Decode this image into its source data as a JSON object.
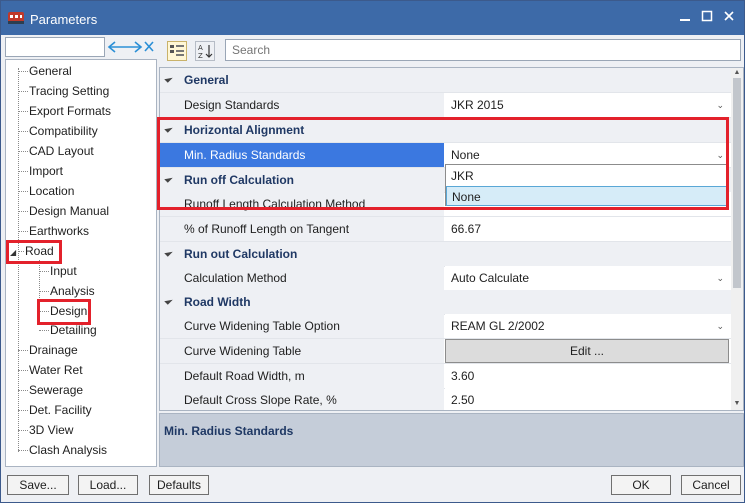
{
  "window": {
    "title": "Parameters",
    "minimize_icon": "minimize-icon",
    "maximize_icon": "maximize-icon",
    "close_icon": "close-icon"
  },
  "tree": {
    "filter_value": "",
    "items": [
      {
        "label": "General"
      },
      {
        "label": "Tracing Setting"
      },
      {
        "label": "Export Formats"
      },
      {
        "label": "Compatibility"
      },
      {
        "label": "CAD Layout"
      },
      {
        "label": "Import"
      },
      {
        "label": "Location"
      },
      {
        "label": "Design Manual"
      },
      {
        "label": "Earthworks"
      },
      {
        "label": "Road"
      },
      {
        "label": "Input"
      },
      {
        "label": "Analysis"
      },
      {
        "label": "Design"
      },
      {
        "label": "Detailing"
      },
      {
        "label": "Drainage"
      },
      {
        "label": "Water Ret"
      },
      {
        "label": "Sewerage"
      },
      {
        "label": "Det. Facility"
      },
      {
        "label": "3D View"
      },
      {
        "label": "Clash Analysis"
      }
    ]
  },
  "toolbar": {
    "search_placeholder": "Search",
    "az_label": "A Z"
  },
  "grid": {
    "general": "General",
    "design_standards": {
      "name": "Design Standards",
      "value": "JKR 2015"
    },
    "horizontal_alignment": "Horizontal Alignment",
    "min_radius": {
      "name": "Min. Radius Standards",
      "value": "None"
    },
    "runoff": "Run off Calculation",
    "runoff_length": {
      "name": "Runoff Length Calculation Method",
      "value": ""
    },
    "runoff_tangent": {
      "name": "% of Runoff Length on Tangent",
      "value": "66.67"
    },
    "runout": "Run out Calculation",
    "calc_method": {
      "name": "Calculation Method",
      "value": "Auto Calculate"
    },
    "road_width": "Road Width",
    "curve_widening_option": {
      "name": "Curve Widening Table Option",
      "value": "REAM GL 2/2002"
    },
    "curve_widening_table": {
      "name": "Curve Widening Table",
      "button": "Edit ..."
    },
    "default_road_width": {
      "name": "Default Road Width, m",
      "value": "3.60"
    },
    "default_cross_slope": {
      "name": "Default Cross Slope Rate, %",
      "value": "2.50"
    }
  },
  "dropdown": {
    "options": [
      "JKR",
      "None"
    ]
  },
  "description": {
    "title": "Min. Radius Standards"
  },
  "buttons": {
    "save": "Save...",
    "load": "Load...",
    "defaults": "Defaults",
    "ok": "OK",
    "cancel": "Cancel"
  },
  "colors": {
    "titlebar": "#3d6aa8",
    "selection": "#3b78e0",
    "highlight_border": "#e3212b"
  }
}
